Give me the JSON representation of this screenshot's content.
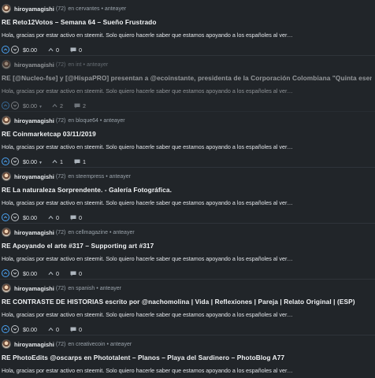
{
  "posts": [
    {
      "author": "hiroyamagishi",
      "reputation": "(72)",
      "category": "cervantes",
      "time": "anteayer",
      "title": "RE Reto12Votos – Semana 64 – Sueño Frustrado",
      "body": "Hola, gracias por estar activo en steemit. Solo quiero hacerle saber que estamos apoyando a los españoles al ver…",
      "payout": "$0.00",
      "payout_caret": "",
      "votes": "0",
      "replies": "0",
      "faded": false
    },
    {
      "author": "hiroyamagishi",
      "reputation": "(72)",
      "category": "int",
      "time": "anteayer",
      "title": "RE [@Nucleo-fse] y [@HispaPRO] presentan a @ecoinstante, presidenta de la Corporación Colombiana \"Quinta esencia\"",
      "body": "Hola, gracias por estar activo en steemit. Solo quiero hacerle saber que estamos apoyando a los españoles al ver…",
      "payout": "$0.00",
      "payout_caret": "▼",
      "votes": "2",
      "replies": "2",
      "faded": true
    },
    {
      "author": "hiroyamagishi",
      "reputation": "(72)",
      "category": "bloque64",
      "time": "anteayer",
      "title": "RE Coinmarketcap 03/11/2019",
      "body": "Hola, gracias por estar activo en steemit. Solo quiero hacerle saber que estamos apoyando a los españoles al ver…",
      "payout": "$0.00",
      "payout_caret": "▼",
      "votes": "1",
      "replies": "1",
      "faded": false
    },
    {
      "author": "hiroyamagishi",
      "reputation": "(72)",
      "category": "steempress",
      "time": "anteayer",
      "title": "RE La naturaleza Sorprendente. - Galería Fotográfica.",
      "body": "Hola, gracias por estar activo en steemit. Solo quiero hacerle saber que estamos apoyando a los españoles al ver…",
      "payout": "$0.00",
      "payout_caret": "",
      "votes": "0",
      "replies": "0",
      "faded": false
    },
    {
      "author": "hiroyamagishi",
      "reputation": "(72)",
      "category": "cellmagazine",
      "time": "anteayer",
      "title": "RE Apoyando el arte #317 – Supporting art #317",
      "body": "Hola, gracias por estar activo en steemit. Solo quiero hacerle saber que estamos apoyando a los españoles al ver…",
      "payout": "$0.00",
      "payout_caret": "",
      "votes": "0",
      "replies": "0",
      "faded": false
    },
    {
      "author": "hiroyamagishi",
      "reputation": "(72)",
      "category": "spanish",
      "time": "anteayer",
      "title": "RE CONTRASTE DE HISTORIAS escrito por @nachomolina | Vida | Reflexiones | Pareja | Relato Original | (ESP)",
      "body": "Hola, gracias por estar activo en steemit. Solo quiero hacerle saber que estamos apoyando a los españoles al ver…",
      "payout": "$0.00",
      "payout_caret": "",
      "votes": "0",
      "replies": "0",
      "faded": false
    },
    {
      "author": "hiroyamagishi",
      "reputation": "(72)",
      "category": "creativecoin",
      "time": "anteayer",
      "title": "RE PhotoEdits @oscarps en Phototalent – Planos – Playa del Sardinero – PhotoBlog A77",
      "body": "Hola, gracias por estar activo en steemit. Solo quiero hacerle saber que estamos apoyando a los españoles al ver…",
      "payout": "$0.00",
      "payout_caret": "",
      "votes": "0",
      "replies": "0",
      "faded": false
    }
  ],
  "labels": {
    "in_prefix": "en",
    "separator": "•"
  },
  "colors": {
    "background": "#212529",
    "upvote": "#4ba2f2",
    "divider": "#2f343a"
  },
  "icons": {
    "upvote": "chevron-up-circle-icon",
    "downvote": "chevron-down-circle-icon",
    "voters": "chevron-up-icon",
    "replies": "comment-icon"
  }
}
